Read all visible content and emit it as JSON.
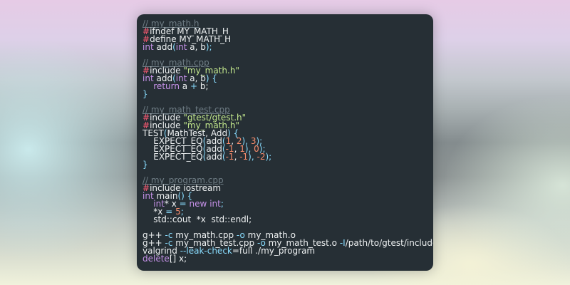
{
  "code_lines": [
    {
      "segments": [
        {
          "t": "// my_math.h",
          "c": "comment"
        }
      ]
    },
    {
      "segments": [
        {
          "t": "#",
          "c": "pp"
        },
        {
          "t": "ifndef MY_MATH_H",
          "c": "ws"
        }
      ]
    },
    {
      "segments": [
        {
          "t": "#",
          "c": "pp"
        },
        {
          "t": "define MY_MATH_H",
          "c": "ws"
        }
      ]
    },
    {
      "segments": [
        {
          "t": "int",
          "c": "kw"
        },
        {
          "t": " add",
          "c": "ws"
        },
        {
          "t": "(",
          "c": "op"
        },
        {
          "t": "int",
          "c": "kw"
        },
        {
          "t": " a, b",
          "c": "ws"
        },
        {
          "t": ");",
          "c": "op"
        }
      ]
    },
    {
      "segments": [
        {
          "t": "",
          "c": "ws"
        }
      ]
    },
    {
      "segments": [
        {
          "t": "// my_math.cpp",
          "c": "comment"
        }
      ]
    },
    {
      "segments": [
        {
          "t": "#",
          "c": "pp"
        },
        {
          "t": "include ",
          "c": "ws"
        },
        {
          "t": "\"my_math.h\"",
          "c": "str"
        }
      ]
    },
    {
      "segments": [
        {
          "t": "int",
          "c": "kw"
        },
        {
          "t": " add",
          "c": "ws"
        },
        {
          "t": "(",
          "c": "op"
        },
        {
          "t": "int",
          "c": "kw"
        },
        {
          "t": " a, b",
          "c": "ws"
        },
        {
          "t": ") {",
          "c": "op"
        }
      ]
    },
    {
      "segments": [
        {
          "t": "    ",
          "c": "ws"
        },
        {
          "t": "return",
          "c": "kw"
        },
        {
          "t": " a ",
          "c": "ws"
        },
        {
          "t": "+",
          "c": "op"
        },
        {
          "t": " b;",
          "c": "ws"
        }
      ]
    },
    {
      "segments": [
        {
          "t": "}",
          "c": "op"
        }
      ]
    },
    {
      "segments": [
        {
          "t": "",
          "c": "ws"
        }
      ]
    },
    {
      "segments": [
        {
          "t": "// my_math_test.cpp",
          "c": "comment"
        }
      ]
    },
    {
      "segments": [
        {
          "t": "#",
          "c": "pp"
        },
        {
          "t": "include ",
          "c": "ws"
        },
        {
          "t": "\"gtest/gtest.h\"",
          "c": "str"
        }
      ]
    },
    {
      "segments": [
        {
          "t": "#",
          "c": "pp"
        },
        {
          "t": "include ",
          "c": "ws"
        },
        {
          "t": "\"my_math.h\"",
          "c": "str"
        }
      ]
    },
    {
      "segments": [
        {
          "t": "TEST",
          "c": "ws"
        },
        {
          "t": "(",
          "c": "op"
        },
        {
          "t": "MathTest, Add",
          "c": "ws"
        },
        {
          "t": ") {",
          "c": "op"
        }
      ]
    },
    {
      "segments": [
        {
          "t": "    EXPECT_EQ",
          "c": "ws"
        },
        {
          "t": "(",
          "c": "op"
        },
        {
          "t": "add",
          "c": "ws"
        },
        {
          "t": "(",
          "c": "op"
        },
        {
          "t": "1",
          "c": "num"
        },
        {
          "t": ", ",
          "c": "ws"
        },
        {
          "t": "2",
          "c": "num"
        },
        {
          "t": "), ",
          "c": "op"
        },
        {
          "t": "3",
          "c": "num"
        },
        {
          "t": ");",
          "c": "op"
        }
      ]
    },
    {
      "segments": [
        {
          "t": "    EXPECT_EQ",
          "c": "ws"
        },
        {
          "t": "(",
          "c": "op"
        },
        {
          "t": "add",
          "c": "ws"
        },
        {
          "t": "(",
          "c": "op"
        },
        {
          "t": "-1",
          "c": "num"
        },
        {
          "t": ", ",
          "c": "ws"
        },
        {
          "t": "1",
          "c": "num"
        },
        {
          "t": "), ",
          "c": "op"
        },
        {
          "t": "0",
          "c": "num"
        },
        {
          "t": ");",
          "c": "op"
        }
      ]
    },
    {
      "segments": [
        {
          "t": "    EXPECT_EQ",
          "c": "ws"
        },
        {
          "t": "(",
          "c": "op"
        },
        {
          "t": "add",
          "c": "ws"
        },
        {
          "t": "(",
          "c": "op"
        },
        {
          "t": "-1",
          "c": "num"
        },
        {
          "t": ", ",
          "c": "ws"
        },
        {
          "t": "-1",
          "c": "num"
        },
        {
          "t": "), ",
          "c": "op"
        },
        {
          "t": "-2",
          "c": "num"
        },
        {
          "t": ");",
          "c": "op"
        }
      ]
    },
    {
      "segments": [
        {
          "t": "}",
          "c": "op"
        }
      ]
    },
    {
      "segments": [
        {
          "t": "",
          "c": "ws"
        }
      ]
    },
    {
      "segments": [
        {
          "t": "// my_program.cpp",
          "c": "comment"
        }
      ]
    },
    {
      "segments": [
        {
          "t": "#",
          "c": "pp"
        },
        {
          "t": "include iostream",
          "c": "ws"
        }
      ]
    },
    {
      "segments": [
        {
          "t": "int",
          "c": "kw"
        },
        {
          "t": " main",
          "c": "ws"
        },
        {
          "t": "() {",
          "c": "op"
        }
      ]
    },
    {
      "segments": [
        {
          "t": "    ",
          "c": "ws"
        },
        {
          "t": "int",
          "c": "kw"
        },
        {
          "t": "* x ",
          "c": "ws"
        },
        {
          "t": "=",
          "c": "op"
        },
        {
          "t": " ",
          "c": "ws"
        },
        {
          "t": "new",
          "c": "kw"
        },
        {
          "t": " ",
          "c": "ws"
        },
        {
          "t": "int",
          "c": "kw"
        },
        {
          "t": ";",
          "c": "op"
        }
      ]
    },
    {
      "segments": [
        {
          "t": "    *x ",
          "c": "ws"
        },
        {
          "t": "=",
          "c": "op"
        },
        {
          "t": " ",
          "c": "ws"
        },
        {
          "t": "5",
          "c": "num"
        },
        {
          "t": ";",
          "c": "op"
        }
      ]
    },
    {
      "segments": [
        {
          "t": "    std::cout  *x  std::endl;",
          "c": "ws"
        }
      ]
    },
    {
      "segments": [
        {
          "t": "",
          "c": "ws"
        }
      ]
    },
    {
      "segments": [
        {
          "t": "g++ ",
          "c": "ws"
        },
        {
          "t": "-c",
          "c": "op"
        },
        {
          "t": " my_math.cpp ",
          "c": "ws"
        },
        {
          "t": "-o",
          "c": "op"
        },
        {
          "t": " my_math.o",
          "c": "ws"
        }
      ]
    },
    {
      "segments": [
        {
          "t": "g++ ",
          "c": "ws"
        },
        {
          "t": "-c",
          "c": "op"
        },
        {
          "t": " my_math_test.cpp ",
          "c": "ws"
        },
        {
          "t": "-o",
          "c": "op"
        },
        {
          "t": " my_math_test.o ",
          "c": "ws"
        },
        {
          "t": "-I",
          "c": "op"
        },
        {
          "t": "/path/to/gtest/include",
          "c": "ws"
        }
      ]
    },
    {
      "segments": [
        {
          "t": "valgrind ",
          "c": "ws"
        },
        {
          "t": "--leak-check",
          "c": "op"
        },
        {
          "t": "=full ./my_program",
          "c": "ws"
        }
      ]
    },
    {
      "segments": [
        {
          "t": "delete",
          "c": "kw"
        },
        {
          "t": "[] x;",
          "c": "ws"
        }
      ]
    }
  ]
}
